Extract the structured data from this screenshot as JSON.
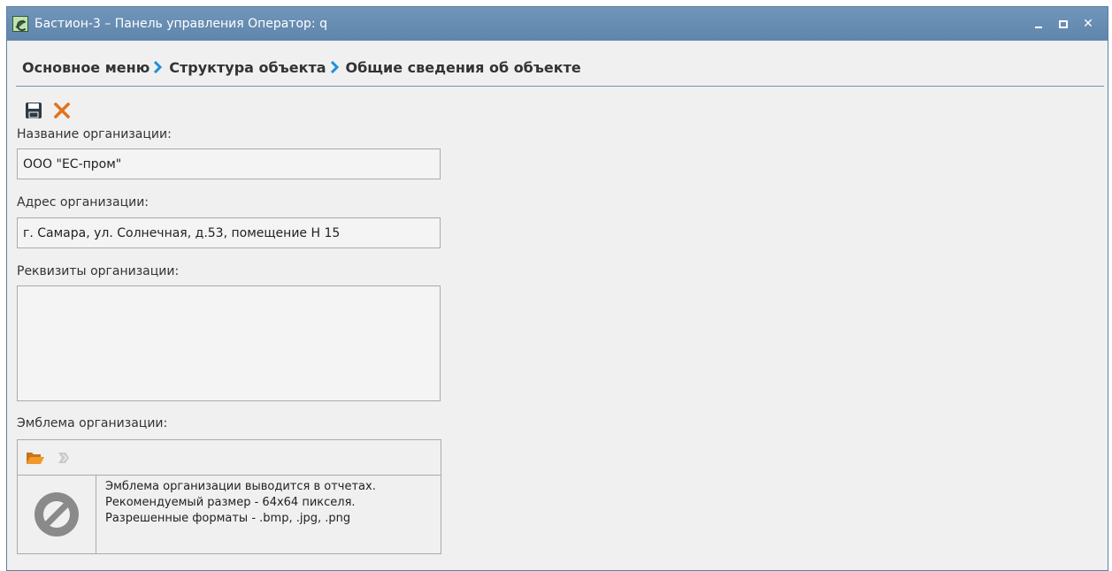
{
  "window": {
    "title": "Бастион-3 – Панель управления Оператор: q",
    "minimize_label": "_",
    "close_label": "✕"
  },
  "breadcrumb": {
    "items": [
      "Основное меню",
      "Структура объекта",
      "Общие сведения об объекте"
    ]
  },
  "form": {
    "org_name_label": "Название организации:",
    "org_name_value": "ООО \"ЕС-пром\"",
    "org_address_label": "Адрес организации:",
    "org_address_value": "г. Самара, ул. Солнечная, д.53, помещение Н 15",
    "org_details_label": "Реквизиты организации:",
    "org_details_value": "",
    "emblem_label": "Эмблема организации:",
    "emblem_info": [
      "Эмблема организации выводится в отчетах.",
      "Рекомендуемый размер - 64x64 пикселя.",
      "Разрешенные форматы - .bmp, .jpg, .png"
    ]
  },
  "icons": {
    "app": "app-icon",
    "save": "save-icon",
    "cancel": "cancel-icon",
    "open_folder": "open-folder-icon",
    "clear": "clear-icon",
    "no_image": "no-image-icon"
  },
  "colors": {
    "titlebar": "#6a8fb3",
    "accent": "#1f8fd6",
    "cancel": "#e3731c",
    "folder": "#e8901e"
  }
}
